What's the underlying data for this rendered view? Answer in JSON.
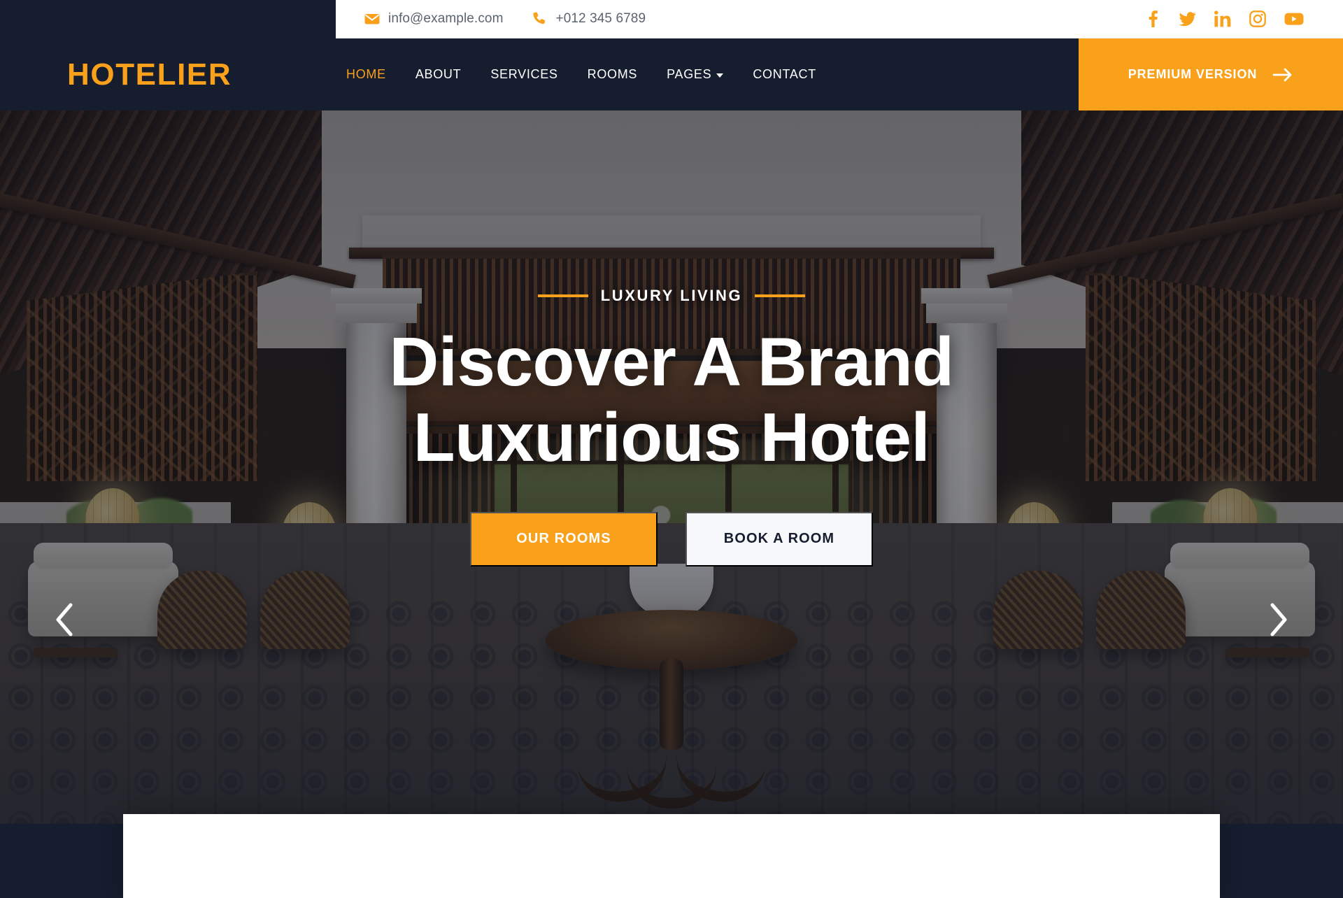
{
  "topbar": {
    "email": "info@example.com",
    "phone": "+012 345 6789",
    "email_icon": "envelope-icon",
    "phone_icon": "phone-icon",
    "social": [
      {
        "name": "facebook-icon",
        "label": "Facebook"
      },
      {
        "name": "twitter-icon",
        "label": "Twitter"
      },
      {
        "name": "linkedin-icon",
        "label": "LinkedIn"
      },
      {
        "name": "instagram-icon",
        "label": "Instagram"
      },
      {
        "name": "youtube-icon",
        "label": "YouTube"
      }
    ]
  },
  "header": {
    "logo": "HOTELIER",
    "nav": [
      {
        "label": "HOME",
        "active": true,
        "dropdown": false
      },
      {
        "label": "ABOUT",
        "active": false,
        "dropdown": false
      },
      {
        "label": "SERVICES",
        "active": false,
        "dropdown": false
      },
      {
        "label": "ROOMS",
        "active": false,
        "dropdown": false
      },
      {
        "label": "PAGES",
        "active": false,
        "dropdown": true
      },
      {
        "label": "CONTACT",
        "active": false,
        "dropdown": false
      }
    ],
    "premium_label": "PREMIUM VERSION",
    "premium_icon": "arrow-right-icon"
  },
  "hero": {
    "eyebrow": "LUXURY LIVING",
    "title_line1": "Discover A Brand",
    "title_line2": "Luxurious Hotel",
    "primary_button": "OUR ROOMS",
    "secondary_button": "BOOK A ROOM",
    "prev_icon": "chevron-left-icon",
    "next_icon": "chevron-right-icon"
  },
  "colors": {
    "accent": "#f9a11b",
    "dark": "#151d2e",
    "white": "#ffffff",
    "muted_text": "#5a636f"
  }
}
